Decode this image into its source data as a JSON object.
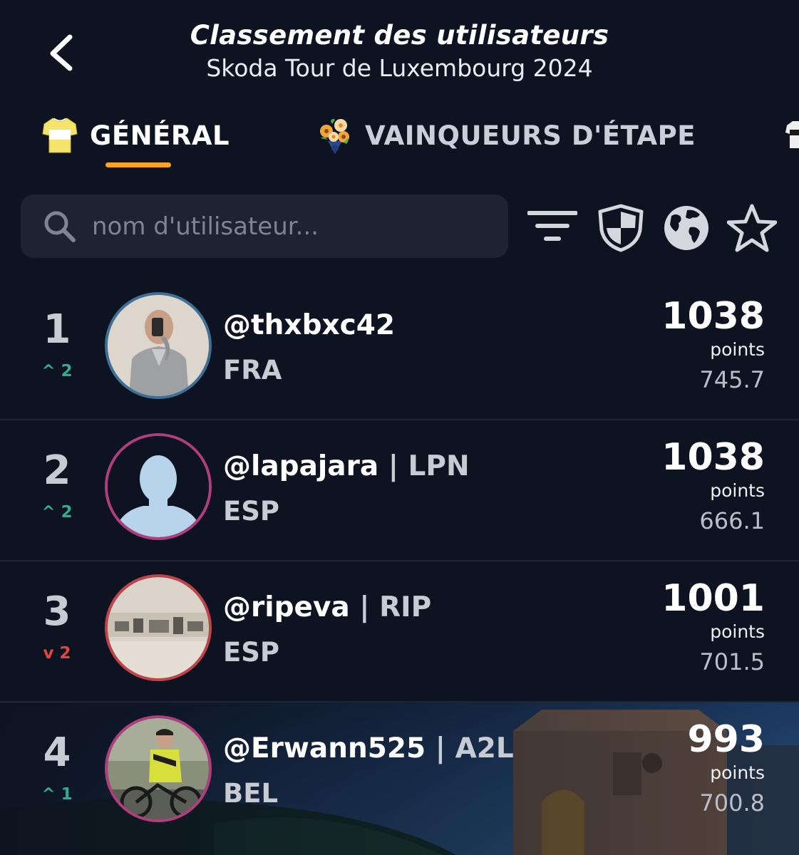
{
  "header": {
    "title": "Classement des utilisateurs",
    "subtitle": "Skoda Tour de Luxembourg 2024"
  },
  "tabs": [
    {
      "label": "GÉNÉRAL",
      "icon": "yellow-jersey-icon",
      "active": true
    },
    {
      "label": "VAINQUEURS D'ÉTAPE",
      "icon": "flower-bouquet-icon",
      "active": false
    }
  ],
  "search": {
    "placeholder": "nom d'utilisateur..."
  },
  "toolbar": {
    "icons": [
      "filter-icon",
      "shield-icon",
      "globe-icon",
      "star-icon"
    ]
  },
  "colors": {
    "background": "#0d1320",
    "accent": "#f6a623",
    "up": "#2fae8f",
    "down": "#e2473f"
  },
  "rows": [
    {
      "rank": "1",
      "change": "^ 2",
      "direction": "up",
      "username": "@thxbxc42",
      "team": "",
      "country": "FRA",
      "points": "1038",
      "points_label": "points",
      "score": "745.7"
    },
    {
      "rank": "2",
      "change": "^ 2",
      "direction": "up",
      "username": "@lapajara",
      "team": "| LPN",
      "country": "ESP",
      "points": "1038",
      "points_label": "points",
      "score": "666.1"
    },
    {
      "rank": "3",
      "change": "v 2",
      "direction": "down",
      "username": "@ripeva",
      "team": "| RIP",
      "country": "ESP",
      "points": "1001",
      "points_label": "points",
      "score": "701.5"
    },
    {
      "rank": "4",
      "change": "^ 1",
      "direction": "up",
      "username": "@Erwann525",
      "team": "| A2L",
      "country": "BEL",
      "points": "993",
      "points_label": "points",
      "score": "700.8"
    }
  ]
}
